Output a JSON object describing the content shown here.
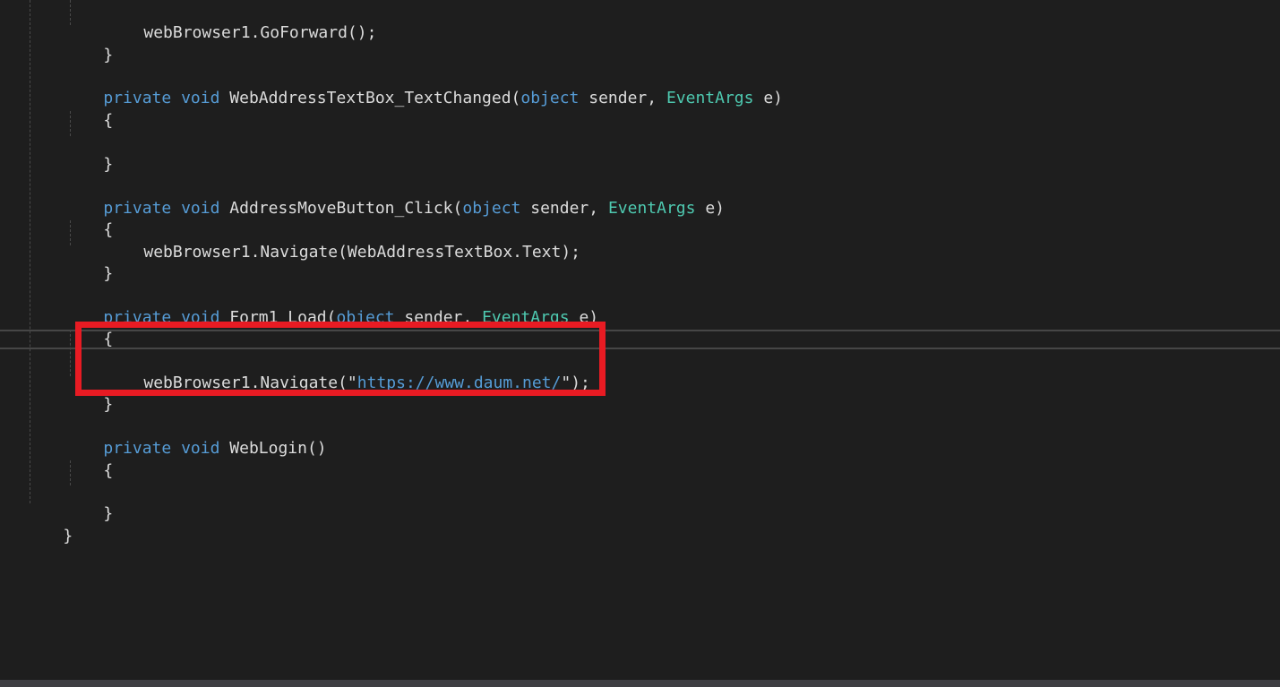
{
  "code": {
    "l01": {
      "method": "webBrowser1.GoForward();"
    },
    "l02": {
      "brace": "}"
    },
    "l03": {
      "kw1": "private",
      "kw2": "void",
      "name": "WebAddressTextBox_TextChanged(",
      "ptype": "object",
      "pname": " sender, ",
      "etype": "EventArgs",
      "tail": " e)"
    },
    "l04": {
      "brace": "{"
    },
    "l05": {
      "brace": "}"
    },
    "l06": {
      "kw1": "private",
      "kw2": "void",
      "name": "AddressMoveButton_Click(",
      "ptype": "object",
      "pname": " sender, ",
      "etype": "EventArgs",
      "tail": " e)"
    },
    "l07": {
      "brace": "{"
    },
    "l08": {
      "method": "webBrowser1.Navigate(WebAddressTextBox.Text);"
    },
    "l09": {
      "brace": "}"
    },
    "l10": {
      "kw1": "private",
      "kw2": "void",
      "name": "Form1_Load(",
      "ptype": "object",
      "pname": " sender, ",
      "etype": "EventArgs",
      "tail": " e)"
    },
    "l11": {
      "brace": "{"
    },
    "l12": {
      "pre": "webBrowser1.Navigate(\"",
      "url": "https://www.daum.net/",
      "post": "\");"
    },
    "l13": {
      "brace": "}"
    },
    "l14": {
      "kw1": "private",
      "kw2": "void",
      "name": "WebLogin()"
    },
    "l15": {
      "brace": "{"
    },
    "l16": {
      "brace": "}"
    },
    "l17": {
      "brace": "}"
    }
  },
  "colors": {
    "background": "#1e1e1e",
    "keyword": "#569cd6",
    "type": "#4ec9b0",
    "text": "#dcdcdc",
    "highlight_box": "#e81b23"
  }
}
